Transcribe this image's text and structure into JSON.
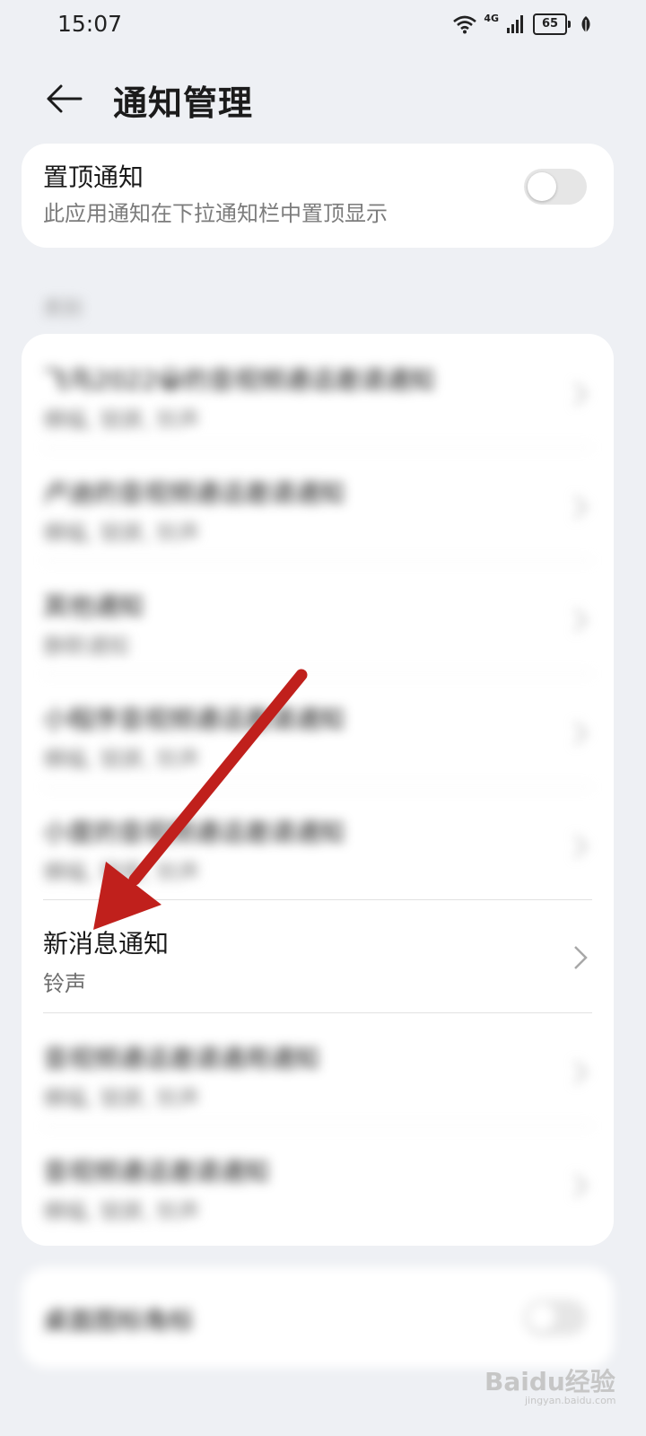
{
  "status_bar": {
    "time": "15:07",
    "network": "4G",
    "battery": "65",
    "icons": [
      "wifi-icon",
      "signal-icon",
      "battery-icon",
      "leaf-icon"
    ]
  },
  "header": {
    "title": "通知管理",
    "back_icon": "back-arrow-icon"
  },
  "pin_notification": {
    "title": "置顶通知",
    "subtitle": "此应用通知在下拉通知栏中置顶显示",
    "enabled": false
  },
  "category_section": {
    "label": "类别",
    "items": [
      {
        "title": "飞鸟2022😀的音视频通话邀请通知",
        "subtitle": "横幅, 锁屏, 铃声"
      },
      {
        "title": "卢迪的音视频通话邀请通知",
        "subtitle": "横幅, 锁屏, 铃声"
      },
      {
        "title": "其他通知",
        "subtitle": "静默通知"
      },
      {
        "title": "小程序音视频通话邀请通知",
        "subtitle": "横幅, 锁屏, 铃声"
      },
      {
        "title": "小度的音视频通话邀请通知",
        "subtitle": "横幅, 锁屏, 铃声"
      },
      {
        "title": "新消息通知",
        "subtitle": "铃声"
      },
      {
        "title": "音视频通话邀请通用通知",
        "subtitle": "横幅, 锁屏, 铃声"
      },
      {
        "title": "音视频通话邀请通知",
        "subtitle": "横幅, 锁屏, 铃声"
      }
    ]
  },
  "desktop_badge": {
    "title": "桌面图标角标",
    "enabled": false
  },
  "annotation": {
    "arrow_color": "#c0201c"
  },
  "watermark": {
    "brand": "Baidu经验",
    "url": "jingyan.baidu.com"
  },
  "colors": {
    "background": "#eef0f4",
    "card": "#ffffff",
    "toggle_off": "#e6e6e6"
  }
}
